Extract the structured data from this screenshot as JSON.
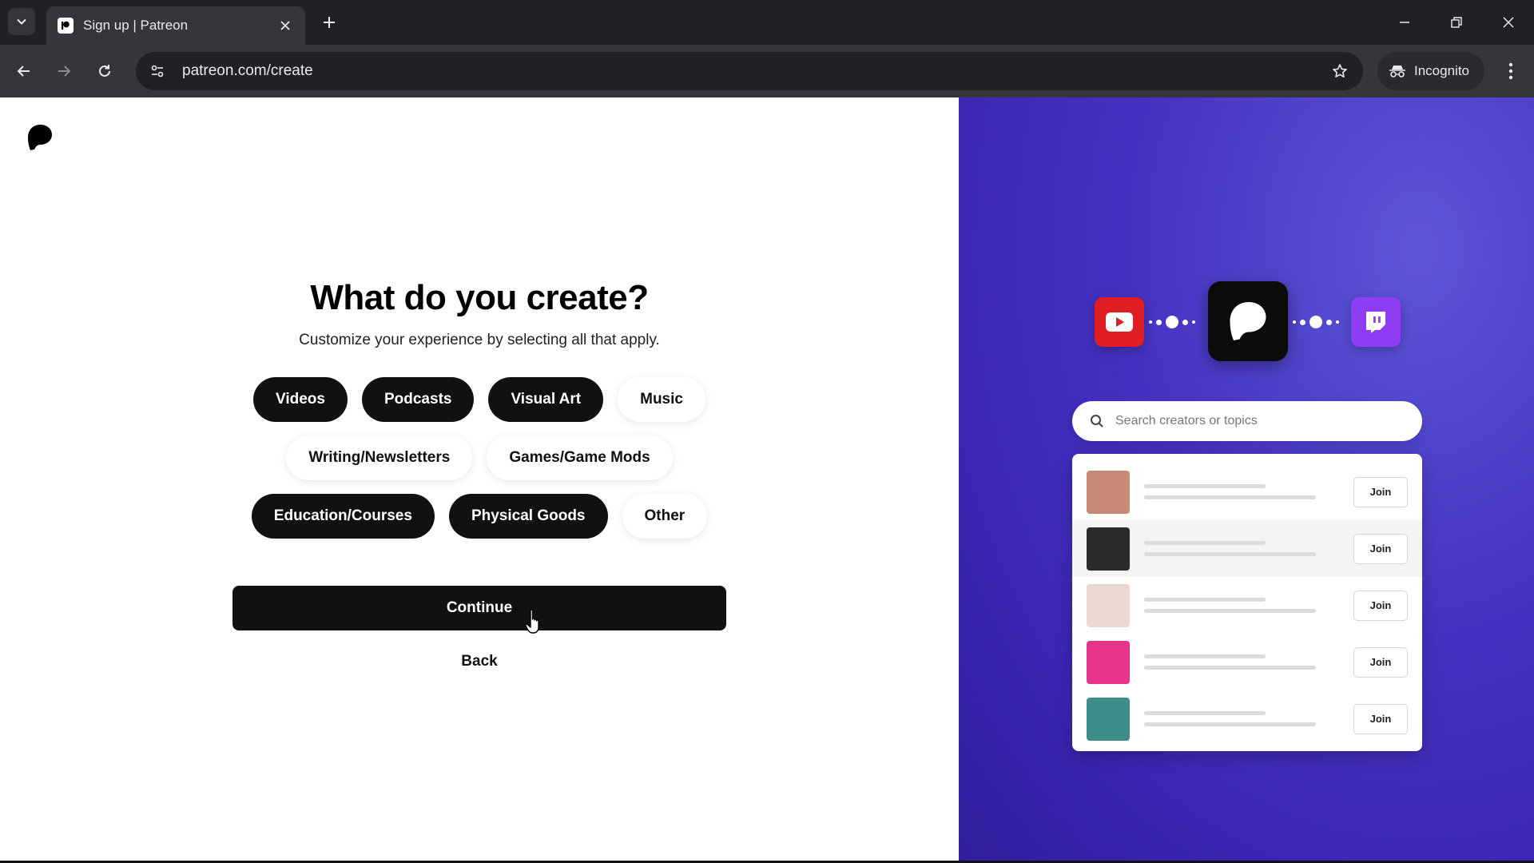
{
  "browser": {
    "tab_title": "Sign up | Patreon",
    "url": "patreon.com/create",
    "incognito_label": "Incognito"
  },
  "page": {
    "heading": "What do you create?",
    "subheading": "Customize your experience by selecting all that apply.",
    "chip_rows": [
      [
        {
          "label": "Videos",
          "selected": true
        },
        {
          "label": "Podcasts",
          "selected": true
        },
        {
          "label": "Visual Art",
          "selected": true
        },
        {
          "label": "Music",
          "selected": false
        }
      ],
      [
        {
          "label": "Writing/Newsletters",
          "selected": false
        },
        {
          "label": "Games/Game Mods",
          "selected": false
        }
      ],
      [
        {
          "label": "Education/Courses",
          "selected": true
        },
        {
          "label": "Physical Goods",
          "selected": true
        },
        {
          "label": "Other",
          "selected": false
        }
      ]
    ],
    "continue_label": "Continue",
    "back_label": "Back"
  },
  "promo": {
    "search_placeholder": "Search creators or topics",
    "creators": [
      {
        "join_label": "Join",
        "avatar_color": "#c98a78",
        "highlighted": false
      },
      {
        "join_label": "Join",
        "avatar_color": "#2b2b2b",
        "highlighted": true
      },
      {
        "join_label": "Join",
        "avatar_color": "#e9d9cf",
        "highlighted": false
      },
      {
        "join_label": "Join",
        "avatar_color": "#e6358a",
        "highlighted": false
      },
      {
        "join_label": "Join",
        "avatar_color": "#3f8c8c",
        "highlighted": false
      }
    ]
  },
  "colors": {
    "chip_selected": "#111111",
    "promo_background": "#4532c2",
    "youtube": "#e01d22",
    "twitch": "#8f3cf5"
  },
  "icons": [
    "patreon-logo-icon",
    "youtube-icon",
    "twitch-icon",
    "search-icon",
    "incognito-icon",
    "star-icon"
  ]
}
